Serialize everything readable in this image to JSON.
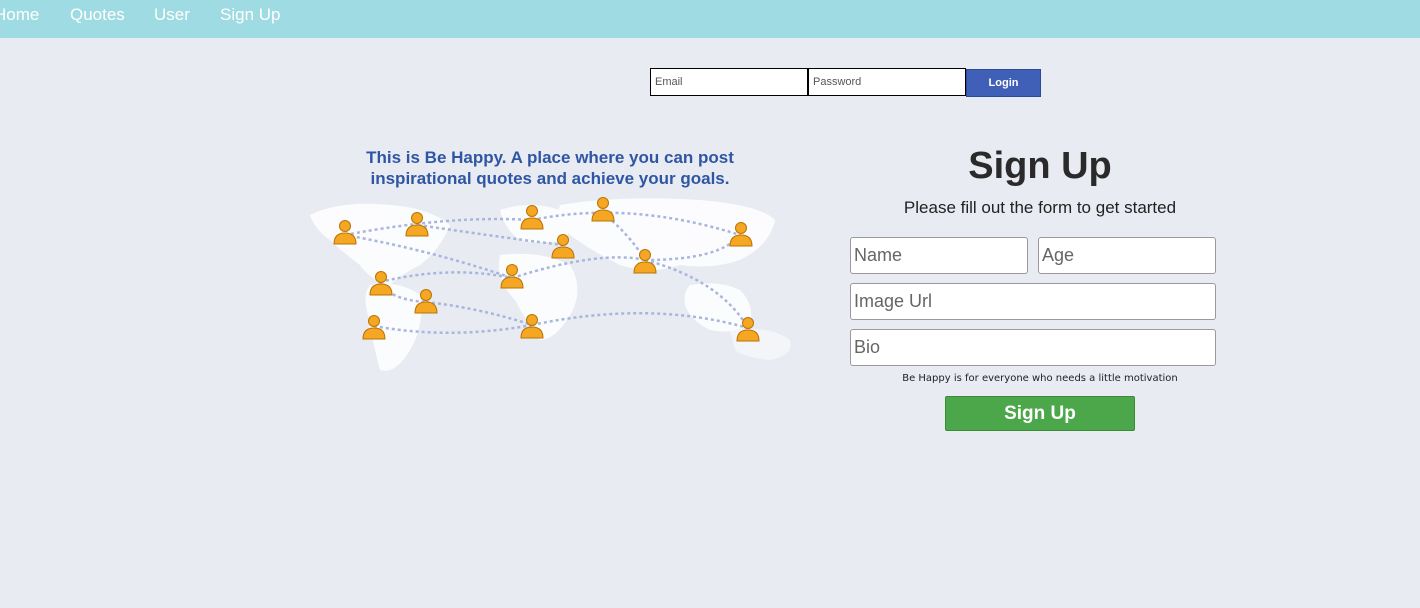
{
  "nav": {
    "home": "Home",
    "quotes": "Quotes",
    "user": "User",
    "signup": "Sign Up"
  },
  "login": {
    "email_placeholder": "Email",
    "password_placeholder": "Password",
    "button": "Login"
  },
  "hero": {
    "tagline_line1": "This is Be Happy. A place where you can post",
    "tagline_line2": "inspirational quotes and achieve your goals."
  },
  "signup": {
    "title": "Sign Up",
    "subtitle": "Please fill out the form to get started",
    "name_placeholder": "Name",
    "age_placeholder": "Age",
    "image_placeholder": "Image Url",
    "bio_placeholder": "Bio",
    "note": "Be Happy is for everyone who needs a little motivation",
    "button": "Sign Up"
  },
  "colors": {
    "navbar": "#9fdbe2",
    "background": "#e9ebf3",
    "login_button": "#4060b8",
    "tagline": "#2f56a3",
    "signup_button": "#4ca64a",
    "person_icon": "#f5a623"
  }
}
